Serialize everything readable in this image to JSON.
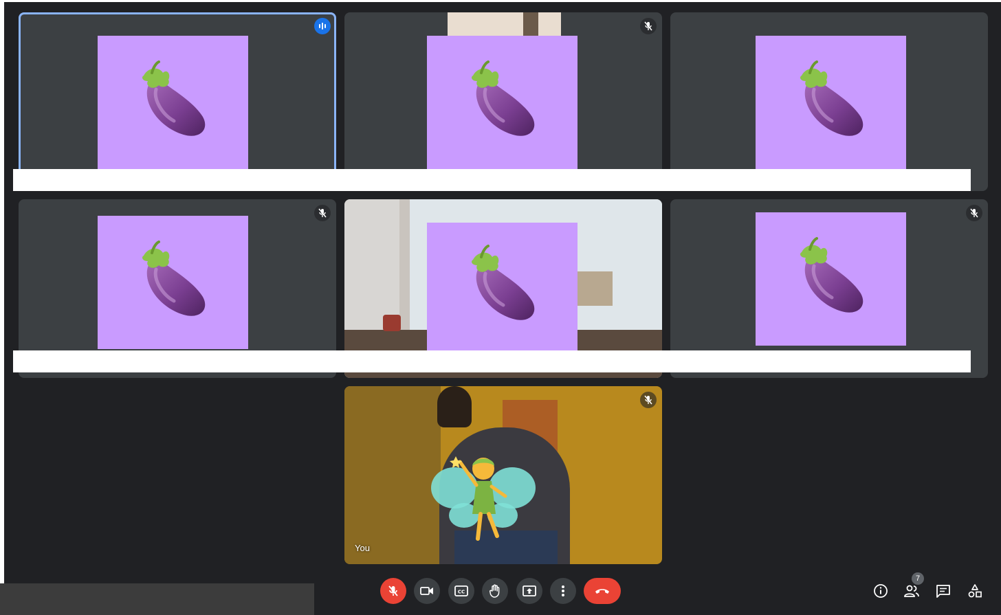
{
  "app": "Google Meet",
  "participants": [
    {
      "avatar": "eggplant-emoji",
      "mic": "speaking",
      "active": true
    },
    {
      "avatar": "eggplant-emoji",
      "mic": "muted",
      "active": false
    },
    {
      "avatar": "eggplant-emoji",
      "mic": "none",
      "active": false
    },
    {
      "avatar": "eggplant-emoji",
      "mic": "muted",
      "active": false
    },
    {
      "avatar": "eggplant-emoji",
      "mic": "none",
      "active": false,
      "background": "winter-cafe-window"
    },
    {
      "avatar": "eggplant-emoji",
      "mic": "muted",
      "active": false
    }
  ],
  "self_tile": {
    "name_label": "You",
    "background": "gold-klimt-painting",
    "overlay": "fairy-emoji",
    "mic": "muted"
  },
  "controls": {
    "microphone": {
      "state": "off",
      "icon": "mic-off-icon"
    },
    "camera": {
      "icon": "videocam-icon"
    },
    "captions": {
      "icon": "closed-caption-icon"
    },
    "raise_hand": {
      "icon": "hand-icon"
    },
    "present": {
      "icon": "present-screen-icon"
    },
    "more": {
      "icon": "more-vert-icon"
    },
    "leave": {
      "icon": "call-end-icon"
    }
  },
  "side_controls": {
    "info_icon": "info-icon",
    "people_icon": "people-icon",
    "people_count": "7",
    "chat_icon": "chat-icon",
    "activities_icon": "activities-icon"
  },
  "colors": {
    "background": "#202124",
    "tile": "#3c4043",
    "avatar_bg": "#c99bff",
    "active_border": "#8ab4f8",
    "speaking": "#1a73e8",
    "danger": "#ea4335"
  }
}
